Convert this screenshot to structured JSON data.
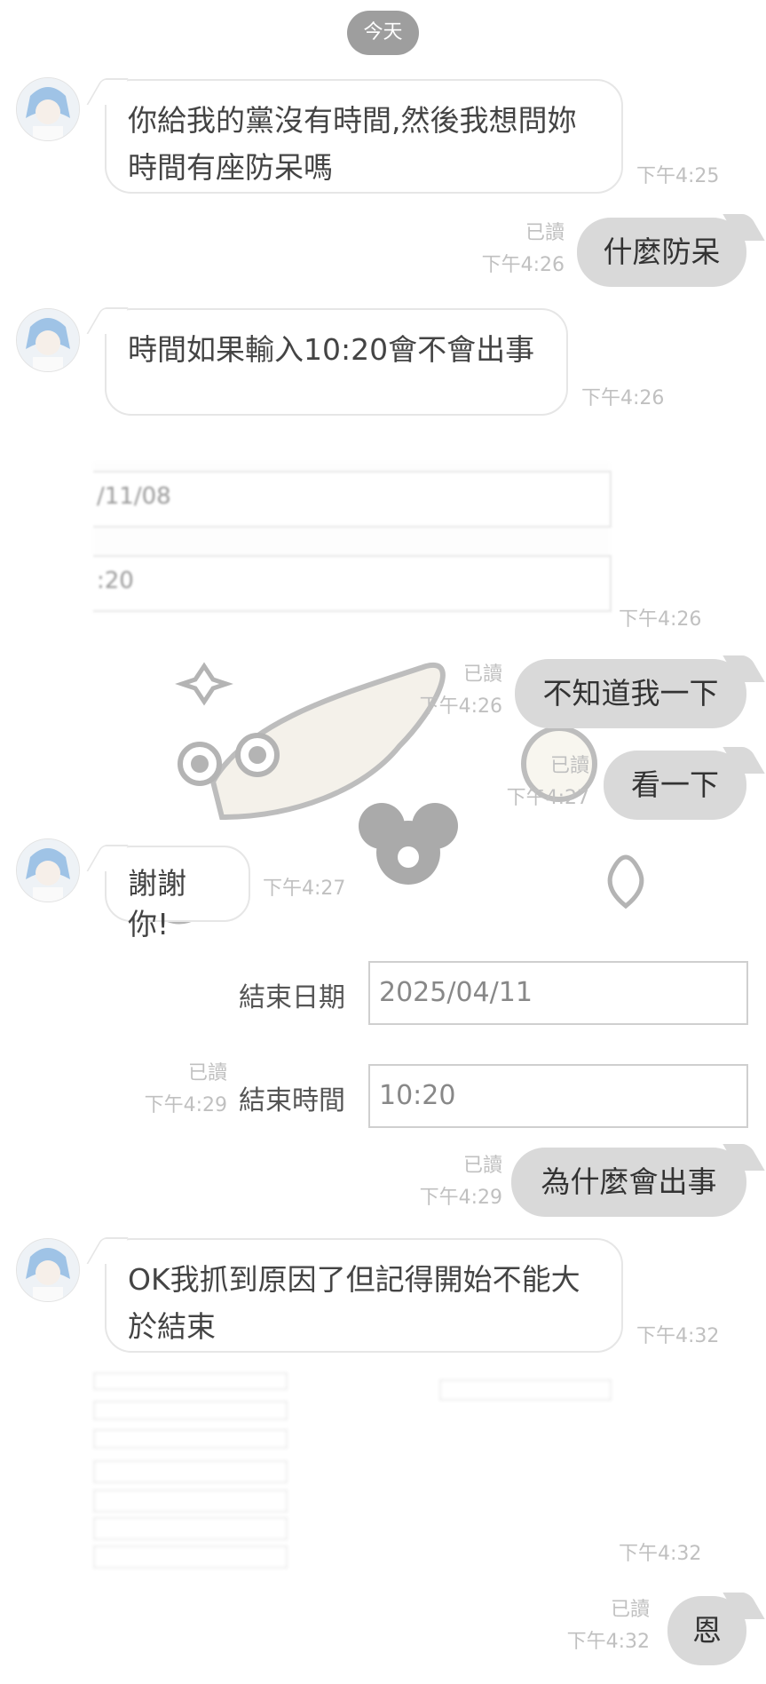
{
  "chat": {
    "date_label": "今天",
    "read_label": "已讀",
    "messages": [
      {
        "text": "你給我的黨沒有時間,然後我想問妳時間有座防呆嗎",
        "time": "下午4:25"
      },
      {
        "text": "什麼防呆",
        "time": "下午4:26"
      },
      {
        "text": "時間如果輸入10:20會不會出事",
        "time": "下午4:26"
      },
      {
        "image_time": "下午4:26"
      },
      {
        "text": "不知道我一下",
        "time": "下午4:26"
      },
      {
        "text": "看一下",
        "time": "下午4:27"
      },
      {
        "text": "謝謝你!",
        "time": "下午4:27"
      },
      {
        "time": "下午4:29"
      },
      {
        "text": "為什麼會出事",
        "time": "下午4:29"
      },
      {
        "text": "OK我抓到原因了但記得開始不能大於結束",
        "time": "下午4:32"
      },
      {
        "image_time": "下午4:32"
      },
      {
        "text": "恩",
        "time": "下午4:32"
      }
    ]
  },
  "screenshot1": {
    "date_value": "/11/08",
    "time_value": ":20"
  },
  "screenshot2": {
    "end_date_label": "結束日期",
    "end_date_value": "2025/04/11",
    "end_time_label": "結束時間",
    "end_time_value": "10:20"
  },
  "colors": {
    "background": "#ffffff",
    "incoming_bubble": "#ffffff",
    "outgoing_bubble": "#d9d9d9",
    "date_pill": "#9e9e9e",
    "meta_text": "#c0c0c0"
  }
}
